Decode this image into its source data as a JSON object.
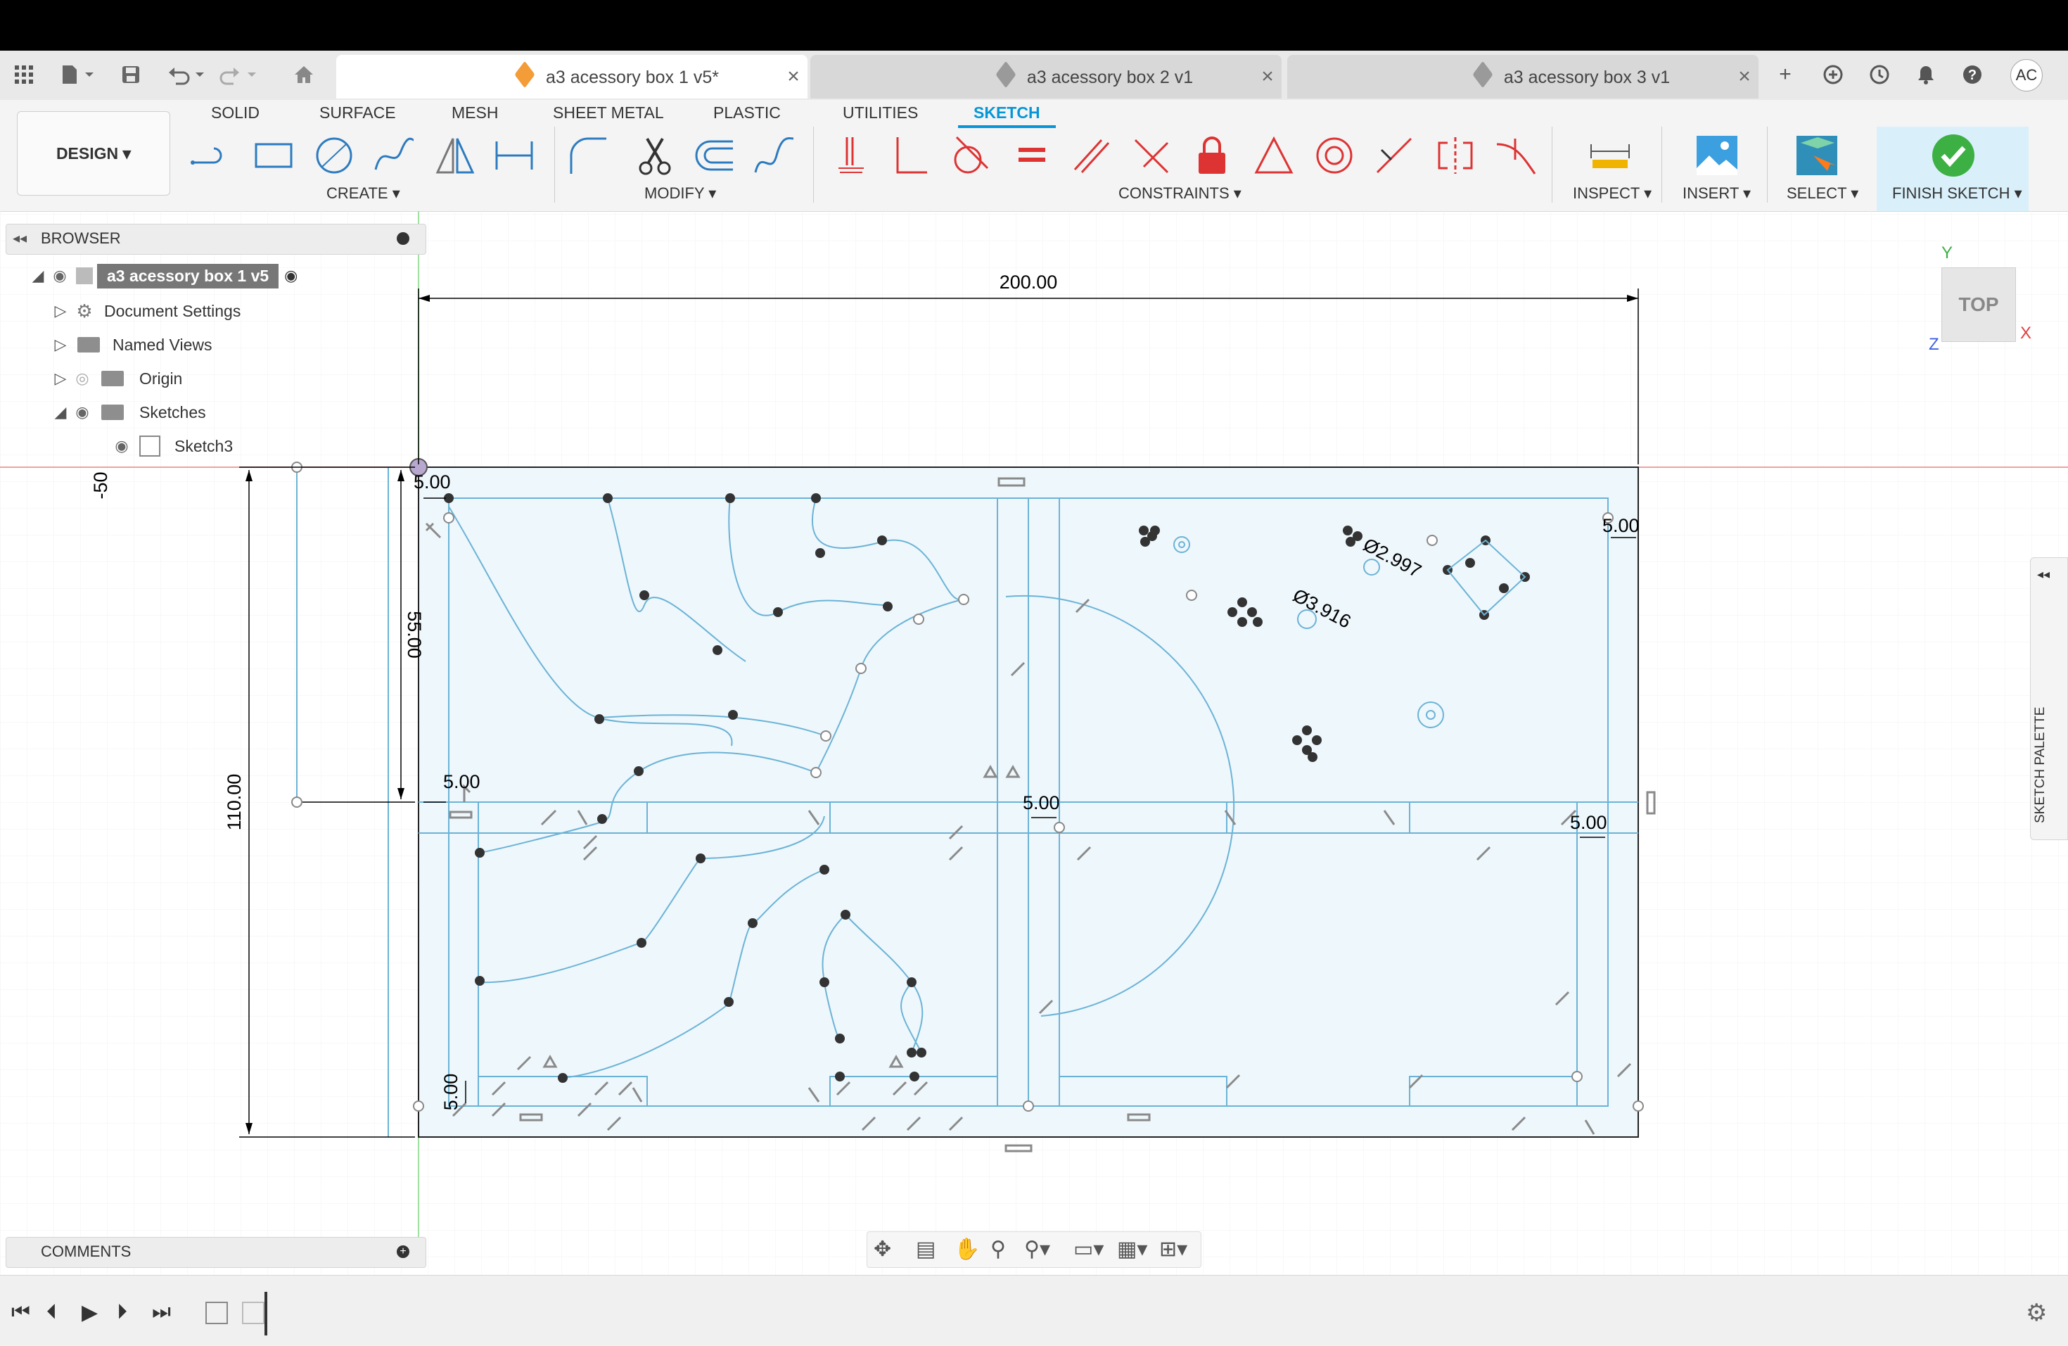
{
  "tabs": [
    {
      "title": "a3 acessory box 1 v5*",
      "active": true
    },
    {
      "title": "a3 acessory box 2 v1",
      "active": false
    },
    {
      "title": "a3 acessory box 3 v1",
      "active": false
    }
  ],
  "user_initials": "AC",
  "modes": [
    "SOLID",
    "SURFACE",
    "MESH",
    "SHEET METAL",
    "PLASTIC",
    "UTILITIES",
    "SKETCH"
  ],
  "active_mode": "SKETCH",
  "workspace": "DESIGN",
  "groups": {
    "create": "CREATE",
    "modify": "MODIFY",
    "constraints": "CONSTRAINTS",
    "inspect": "INSPECT",
    "insert": "INSERT",
    "select": "SELECT",
    "finish": "FINISH SKETCH"
  },
  "browser": {
    "title": "BROWSER",
    "root": "a3 acessory box 1 v5",
    "items": [
      "Document Settings",
      "Named Views",
      "Origin",
      "Sketches",
      "Sketch3"
    ]
  },
  "comments": "COMMENTS",
  "viewcube": {
    "face": "TOP",
    "y": "Y",
    "x": "X",
    "z": "Z"
  },
  "sketch_palette": "SKETCH PALETTE",
  "dimensions": {
    "width": "200.00",
    "height": "110.00",
    "inner": "55.00",
    "offset": "5.00",
    "neg50": "-50",
    "dia1": "Ø2.997",
    "dia2": "Ø3.916"
  },
  "colors": {
    "accent": "#0696d7",
    "sketch_line": "#5aa9c9",
    "sketch_fill": "#eef7fc",
    "finish_check": "#3cb043"
  }
}
